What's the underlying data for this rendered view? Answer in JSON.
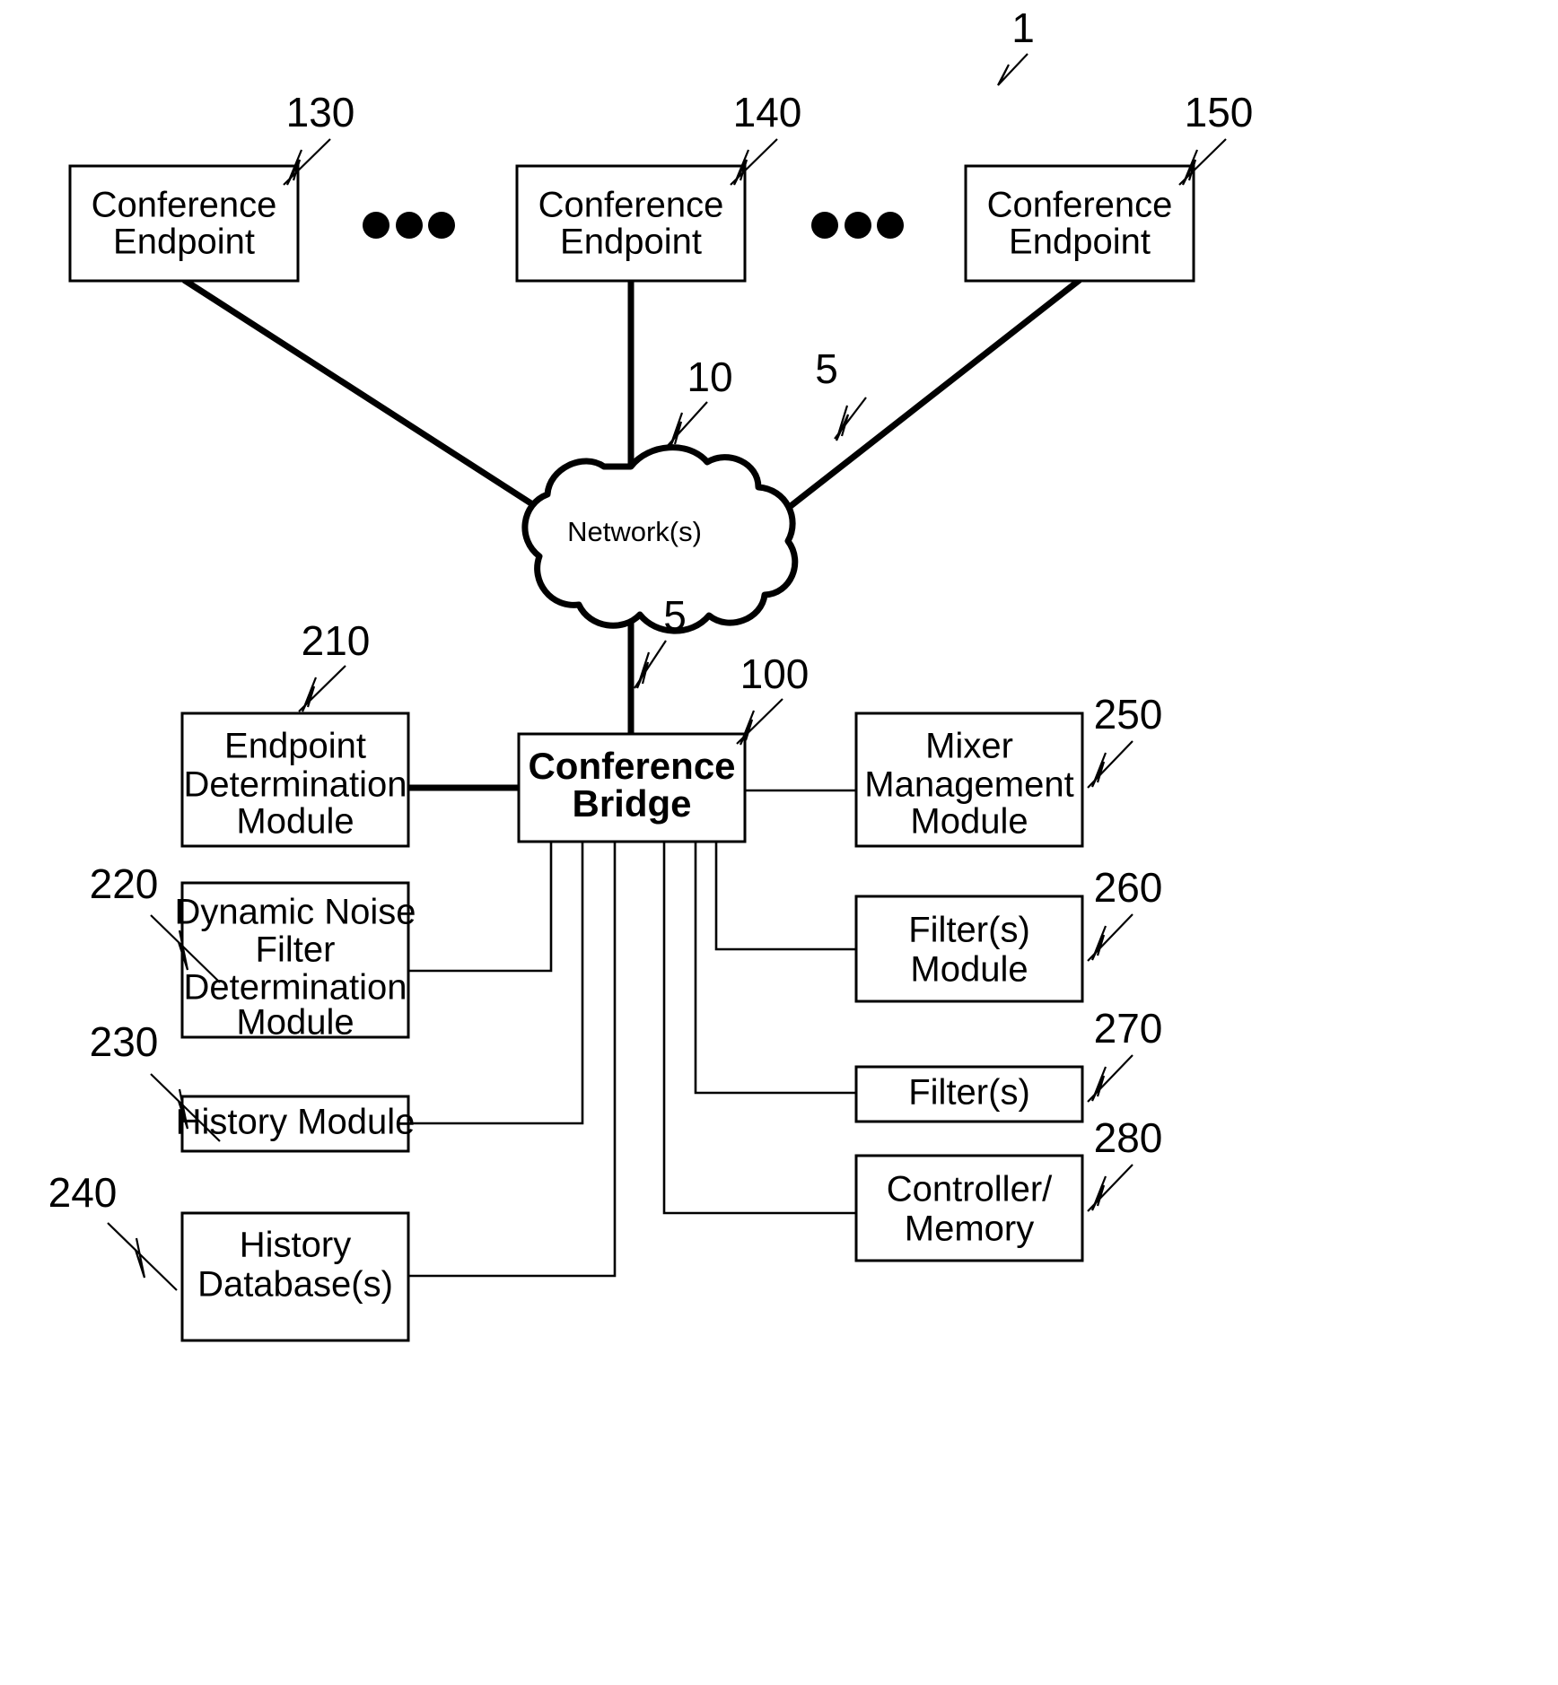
{
  "figure": {
    "figure_ref": "1",
    "nodes": {
      "endpoint_left": {
        "label_line1": "Conference",
        "label_line2": "Endpoint",
        "ref": "130"
      },
      "endpoint_mid": {
        "label_line1": "Conference",
        "label_line2": "Endpoint",
        "ref": "140"
      },
      "endpoint_right": {
        "label_line1": "Conference",
        "label_line2": "Endpoint",
        "ref": "150"
      },
      "network": {
        "label": "Network(s)",
        "ref": "10"
      },
      "bridge": {
        "label_line1": "Conference",
        "label_line2": "Bridge",
        "ref": "100"
      },
      "endpoint_determination": {
        "label_line1": "Endpoint",
        "label_line2": "Determination",
        "label_line3": "Module",
        "ref": "210"
      },
      "dynamic_noise_filter": {
        "label_line1": "Dynamic Noise",
        "label_line2": "Filter",
        "label_line3": "Determination",
        "label_line4": "Module",
        "ref": "220"
      },
      "history_module": {
        "label_line1": "History Module",
        "ref": "230"
      },
      "history_database": {
        "label_line1": "History",
        "label_line2": "Database(s)",
        "ref": "240"
      },
      "mixer_management": {
        "label_line1": "Mixer",
        "label_line2": "Management",
        "label_line3": "Module",
        "ref": "250"
      },
      "filters_module": {
        "label_line1": "Filter(s)",
        "label_line2": "Module",
        "ref": "260"
      },
      "filters": {
        "label_line1": "Filter(s)",
        "ref": "270"
      },
      "controller_memory": {
        "label_line1": "Controller/",
        "label_line2": "Memory",
        "ref": "280"
      }
    },
    "link_refs": {
      "link_right": "5",
      "link_bottom": "5"
    },
    "ellipsis_left": "•••",
    "ellipsis_right": "•••",
    "colors": {
      "ink": "#000000",
      "paper": "#ffffff"
    }
  }
}
